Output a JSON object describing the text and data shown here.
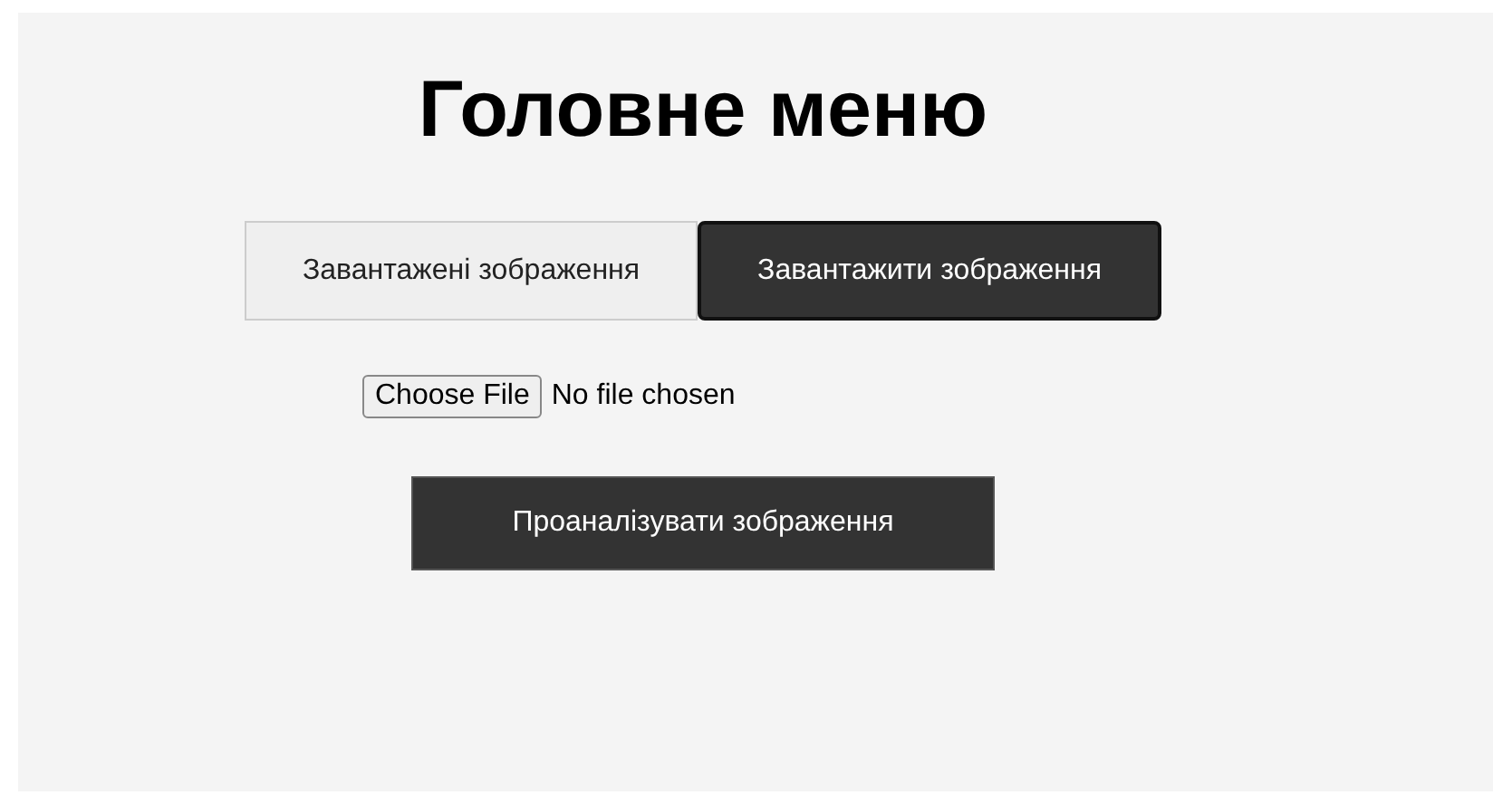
{
  "title": "Головне меню",
  "tabs": [
    {
      "label": "Завантажені зображення",
      "selected": false
    },
    {
      "label": "Завантажити зображення",
      "selected": true
    }
  ],
  "file_input": {
    "button": "Choose File",
    "status": "No file chosen"
  },
  "analyze_button": "Проаналізувати зображення"
}
